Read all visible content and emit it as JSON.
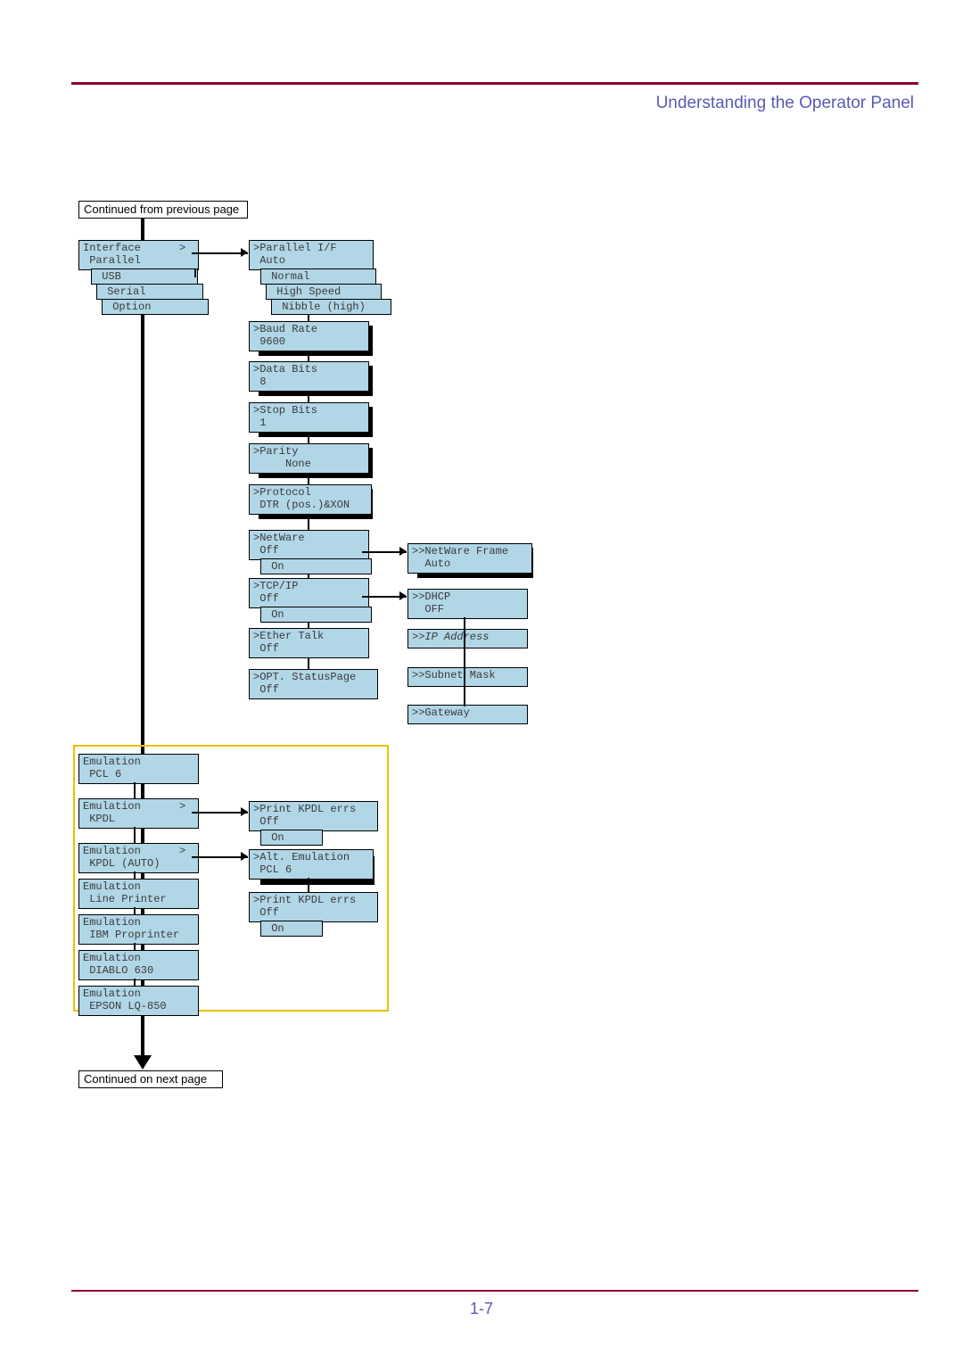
{
  "header": "Understanding the Operator Panel",
  "continued_prev": "Continued from previous page",
  "continued_next": "Continued on next page",
  "page_no": "1-7",
  "interface": {
    "l1": "Interface      >",
    "l2": " Parallel",
    "usb": " USB",
    "serial": " Serial",
    "option": " Option"
  },
  "parallel": {
    "l1": ">Parallel I/F",
    "l2": " Auto",
    "normal": " Normal",
    "high": " High Speed",
    "nibble": " Nibble (high)"
  },
  "baud": {
    "l1": ">Baud Rate",
    "l2": " 9600"
  },
  "databits": {
    "l1": ">Data Bits",
    "l2": " 8"
  },
  "stopbits": {
    "l1": ">Stop Bits",
    "l2": " 1"
  },
  "parity": {
    "l1": ">Parity",
    "l2": "     None"
  },
  "protocol": {
    "l1": ">Protocol",
    "l2": " DTR (pos.)&XON"
  },
  "netware": {
    "l1": ">NetWare",
    "l2": " Off",
    "on": " On"
  },
  "tcpip": {
    "l1": ">TCP/IP",
    "l2": " Off",
    "on": " On"
  },
  "ether": {
    "l1": ">Ether Talk",
    "l2": " Off"
  },
  "opt": {
    "l1": ">OPT. StatusPage",
    "l2": " Off"
  },
  "nwframe": {
    "l1": ">>NetWare Frame",
    "l2": "  Auto"
  },
  "dhcp": {
    "l1": ">>DHCP",
    "l2": "  OFF"
  },
  "ipaddr": ">>IP Address",
  "subnet": ">>Subnet Mask",
  "gateway": ">>Gateway",
  "emu1": {
    "l1": "Emulation",
    "l2": " PCL 6"
  },
  "emu2": {
    "l1": "Emulation      >",
    "l2": " KPDL"
  },
  "emu3": {
    "l1": "Emulation      >",
    "l2": " KPDL (AUTO)"
  },
  "emu4": {
    "l1": "Emulation",
    "l2": " Line Printer"
  },
  "emu5": {
    "l1": "Emulation",
    "l2": " IBM Proprinter"
  },
  "emu6": {
    "l1": "Emulation",
    "l2": " DIABLO 630"
  },
  "emu7": {
    "l1": "Emulation",
    "l2": " EPSON LQ-850"
  },
  "kpdl": {
    "l1": ">Print KPDL errs",
    "l2": " Off",
    "on": " On"
  },
  "alt": {
    "l1": ">Alt. Emulation",
    "l2": " PCL 6"
  },
  "kpdl2": {
    "l1": ">Print KPDL errs",
    "l2": " Off",
    "on": " On"
  }
}
